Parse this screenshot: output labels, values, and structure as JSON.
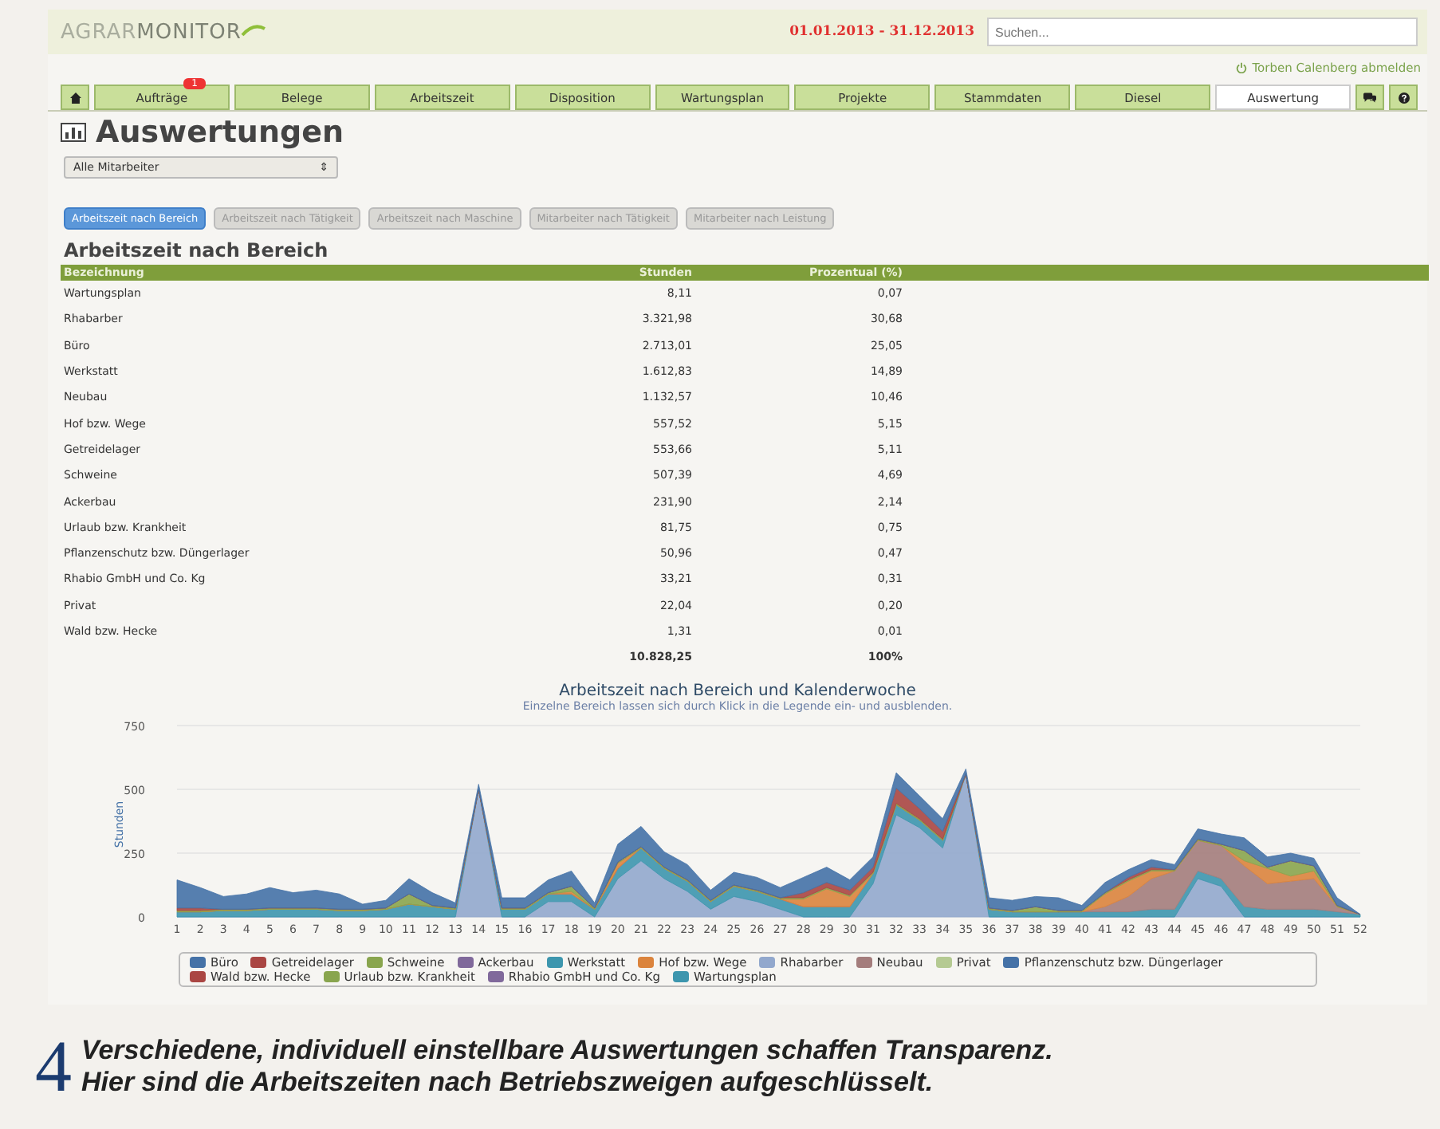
{
  "header": {
    "logo_light": "AGRAR",
    "logo_dark": "MONITOR",
    "date_range": "01.01.2013 - 31.12.2013",
    "search": {
      "placeholder": "Suchen..."
    },
    "logout": "Torben Calenberg abmelden"
  },
  "tabs": [
    {
      "kind": "home",
      "selected": false
    },
    {
      "kind": "text",
      "label": "Aufträge",
      "badge": "1",
      "selected": false
    },
    {
      "kind": "text",
      "label": "Belege",
      "selected": false
    },
    {
      "kind": "text",
      "label": "Arbeitszeit",
      "selected": false
    },
    {
      "kind": "text",
      "label": "Disposition",
      "selected": false
    },
    {
      "kind": "text",
      "label": "Wartungsplan",
      "selected": false
    },
    {
      "kind": "text",
      "label": "Projekte",
      "selected": false
    },
    {
      "kind": "text",
      "label": "Stammdaten",
      "selected": false
    },
    {
      "kind": "text",
      "label": "Diesel",
      "selected": false
    },
    {
      "kind": "text",
      "label": "Auswertung",
      "selected": true
    },
    {
      "kind": "messages",
      "selected": false
    },
    {
      "kind": "help",
      "selected": false
    }
  ],
  "page_title": "Auswertungen",
  "employee_select": {
    "value": "Alle Mitarbeiter",
    "arrow": "⇕"
  },
  "report_buttons": [
    {
      "label": "Arbeitszeit nach Bereich",
      "selected": true
    },
    {
      "label": "Arbeitszeit nach Tätigkeit",
      "selected": false
    },
    {
      "label": "Arbeitszeit nach Maschine",
      "selected": false
    },
    {
      "label": "Mitarbeiter nach Tätigkeit",
      "selected": false
    },
    {
      "label": "Mitarbeiter nach Leistung",
      "selected": false
    }
  ],
  "section_title": "Arbeitszeit nach Bereich",
  "table": {
    "columns": [
      "Bezeichnung",
      "Stunden",
      "Prozentual (%)"
    ],
    "rows": [
      [
        "Wartungsplan",
        "8,11",
        "0,07"
      ],
      [
        "Rhabarber",
        "3.321,98",
        "30,68"
      ],
      [
        "Büro",
        "2.713,01",
        "25,05"
      ],
      [
        "Werkstatt",
        "1.612,83",
        "14,89"
      ],
      [
        "Neubau",
        "1.132,57",
        "10,46"
      ],
      [
        "Hof bzw. Wege",
        "557,52",
        "5,15"
      ],
      [
        "Getreidelager",
        "553,66",
        "5,11"
      ],
      [
        "Schweine",
        "507,39",
        "4,69"
      ],
      [
        "Ackerbau",
        "231,90",
        "2,14"
      ],
      [
        "Urlaub bzw. Krankheit",
        "81,75",
        "0,75"
      ],
      [
        "Pflanzenschutz bzw. Düngerlager",
        "50,96",
        "0,47"
      ],
      [
        "Rhabio GmbH und Co. Kg",
        "33,21",
        "0,31"
      ],
      [
        "Privat",
        "22,04",
        "0,20"
      ],
      [
        "Wald bzw. Hecke",
        "1,31",
        "0,01"
      ]
    ],
    "totals": [
      "10.828,25",
      "100%"
    ]
  },
  "chart": {
    "title": "Arbeitszeit nach Bereich und Kalenderwoche",
    "subtitle": "Einzelne Bereich lassen sich durch Klick in die Legende ein- und ausblenden.",
    "ylabel": "Stunden",
    "yticks": [
      "750",
      "500",
      "250",
      "0"
    ],
    "weeks": [
      "1",
      "2",
      "3",
      "4",
      "5",
      "6",
      "7",
      "8",
      "9",
      "10",
      "11",
      "12",
      "13",
      "14",
      "15",
      "16",
      "17",
      "18",
      "19",
      "20",
      "21",
      "22",
      "23",
      "24",
      "25",
      "26",
      "27",
      "28",
      "29",
      "30",
      "31",
      "32",
      "33",
      "34",
      "35",
      "36",
      "37",
      "38",
      "39",
      "40",
      "41",
      "42",
      "43",
      "44",
      "45",
      "46",
      "47",
      "48",
      "49",
      "50",
      "51",
      "52"
    ],
    "legend": [
      {
        "name": "Büro",
        "color": "#4572a7"
      },
      {
        "name": "Getreidelager",
        "color": "#aa4643"
      },
      {
        "name": "Schweine",
        "color": "#89a54e"
      },
      {
        "name": "Ackerbau",
        "color": "#80699b"
      },
      {
        "name": "Werkstatt",
        "color": "#3d96ae"
      },
      {
        "name": "Hof bzw. Wege",
        "color": "#db843d"
      },
      {
        "name": "Rhabarber",
        "color": "#92a8cd"
      },
      {
        "name": "Neubau",
        "color": "#a47d7c"
      },
      {
        "name": "Privat",
        "color": "#b5ca92"
      },
      {
        "name": "Pflanzenschutz bzw. Düngerlager",
        "color": "#4572a7"
      },
      {
        "name": "Wald bzw. Hecke",
        "color": "#aa4643"
      },
      {
        "name": "Urlaub bzw. Krankheit",
        "color": "#89a54e"
      },
      {
        "name": "Rhabio GmbH und Co. Kg",
        "color": "#80699b"
      },
      {
        "name": "Wartungsplan",
        "color": "#3d96ae"
      }
    ]
  },
  "caption": {
    "number": "4",
    "lines": [
      "Verschiedene, individuell einstellbare Auswertungen schaffen Transparenz.",
      "Hier sind die Arbeitszeiten nach Betriebszweigen aufgeschlüsselt."
    ]
  }
}
